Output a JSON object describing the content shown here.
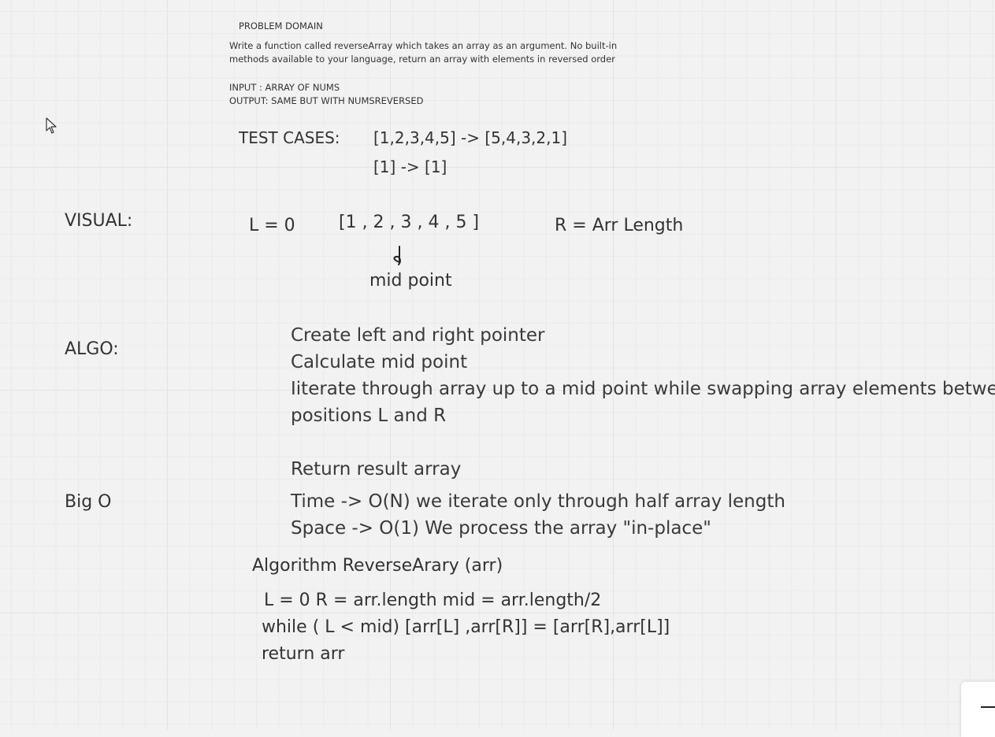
{
  "board": {
    "problem_domain_title": "PROBLEM DOMAIN",
    "description_line1": "Write a function called reverseArray which takes an array as an argument.  No built-in",
    "description_line2": "methods available to your language, return an array with elements in reversed order",
    "input_line": "INPUT : ARRAY OF NUMS",
    "output_line": "OUTPUT: SAME BUT WITH NUMSREVERSED",
    "test_cases_label": "TEST CASES:",
    "test_case_1": "[1,2,3,4,5]  -> [5,4,3,2,1]",
    "test_case_2": "[1]  ->  [1]",
    "visual_label": "VISUAL:",
    "visual_left": "L = 0",
    "visual_array": "[1 , 2 , 3 , 4 , 5 ]",
    "visual_right": "R = Arr Length",
    "visual_mid": "mid point",
    "algo_label": "ALGO:",
    "algo_steps": [
      "Create left and right pointer",
      "Calculate mid point",
      "Iiterate through array up to a mid point while  swapping array elements between",
      "positions L and R",
      "Return result array"
    ],
    "bigo_label": "Big O",
    "bigo_time": "Time -> O(N) we iterate only through half array length",
    "bigo_space": "Space -> O(1)  We process the array \"in-place\"",
    "pseudo_title": "Algorithm ReverseArary (arr)",
    "pseudo_line1": "L = 0   R = arr.length  mid = arr.length/2",
    "pseudo_line2": "while ( L < mid)  [arr[L] ,arr[R]] =  [arr[R],arr[L]]",
    "pseudo_line3": "return arr"
  },
  "icons": {
    "cursor": "mouse-pointer-icon",
    "arrow": "hand-drawn-down-arrow",
    "zoom_out": "minus-icon"
  }
}
